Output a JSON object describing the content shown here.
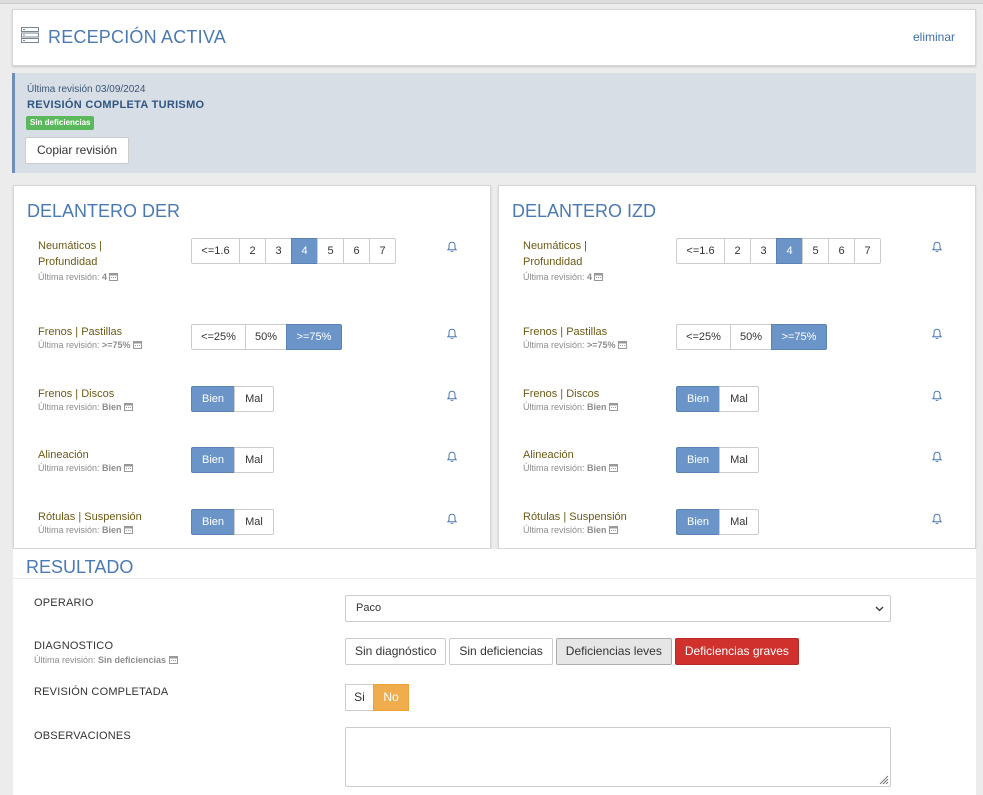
{
  "header": {
    "title": "RECEPCIÓN ACTIVA",
    "delete_label": "eliminar",
    "icon": "server-list-icon"
  },
  "last_revision": {
    "date_text": "Última revisión 03/09/2024",
    "title": "REVISIÓN COMPLETA TURISMO",
    "badge": "Sin deficiencias",
    "copy_button": "Copiar revisión"
  },
  "panels": [
    {
      "title": "DELANTERO DER",
      "rows": [
        {
          "label_line1": "Neumáticos |",
          "label_line2": "Profundidad",
          "sub_prefix": "Última revisión:",
          "sub_value": "4",
          "options": [
            "<=1.6",
            "2",
            "3",
            "4",
            "5",
            "6",
            "7"
          ],
          "selected": "4"
        },
        {
          "label_line1": "Frenos | Pastillas",
          "sub_prefix": "Última revisión:",
          "sub_value": ">=75%",
          "options": [
            "<=25%",
            "50%",
            ">=75%"
          ],
          "selected": ">=75%"
        },
        {
          "label_line1": "Frenos | Discos",
          "sub_prefix": "Última revisión:",
          "sub_value": "Bien",
          "options": [
            "Bien",
            "Mal"
          ],
          "selected": "Bien"
        },
        {
          "label_line1": "Alineación",
          "sub_prefix": "Última revisión:",
          "sub_value": "Bien",
          "options": [
            "Bien",
            "Mal"
          ],
          "selected": "Bien"
        },
        {
          "label_line1": "Rótulas | Suspensión",
          "sub_prefix": "Última revisión:",
          "sub_value": "Bien",
          "options": [
            "Bien",
            "Mal"
          ],
          "selected": "Bien"
        }
      ]
    },
    {
      "title": "DELANTERO IZD",
      "rows": [
        {
          "label_line1": "Neumáticos |",
          "label_line2": "Profundidad",
          "sub_prefix": "Última revisión:",
          "sub_value": "4",
          "options": [
            "<=1.6",
            "2",
            "3",
            "4",
            "5",
            "6",
            "7"
          ],
          "selected": "4"
        },
        {
          "label_line1": "Frenos | Pastillas",
          "sub_prefix": "Última revisión:",
          "sub_value": ">=75%",
          "options": [
            "<=25%",
            "50%",
            ">=75%"
          ],
          "selected": ">=75%"
        },
        {
          "label_line1": "Frenos | Discos",
          "sub_prefix": "Última revisión:",
          "sub_value": "Bien",
          "options": [
            "Bien",
            "Mal"
          ],
          "selected": "Bien"
        },
        {
          "label_line1": "Alineación",
          "sub_prefix": "Última revisión:",
          "sub_value": "Bien",
          "options": [
            "Bien",
            "Mal"
          ],
          "selected": "Bien"
        },
        {
          "label_line1": "Rótulas | Suspensión",
          "sub_prefix": "Última revisión:",
          "sub_value": "Bien",
          "options": [
            "Bien",
            "Mal"
          ],
          "selected": "Bien"
        }
      ]
    }
  ],
  "result": {
    "title": "RESULTADO",
    "operario_label": "OPERARIO",
    "operario_value": "Paco",
    "diagnostico_label": "DIAGNOSTICO",
    "diagnostico_sub_prefix": "Última revisión:",
    "diagnostico_sub_value": "Sin deficiencias",
    "diagnostico_options": [
      "Sin diagnóstico",
      "Sin deficiencias",
      "Deficiencias leves",
      "Deficiencias graves"
    ],
    "diagnostico_selected": "Deficiencias graves",
    "completada_label": "REVISIÓN COMPLETADA",
    "completada_options": [
      "Si",
      "No"
    ],
    "completada_selected": "No",
    "observaciones_label": "OBSERVACIONES",
    "observaciones_value": ""
  },
  "colors": {
    "accent": "#4a7ab3",
    "selected_segment": "#6b95c8",
    "success": "#5cb85c",
    "danger": "#d0312d",
    "warning": "#f0ad4e"
  }
}
